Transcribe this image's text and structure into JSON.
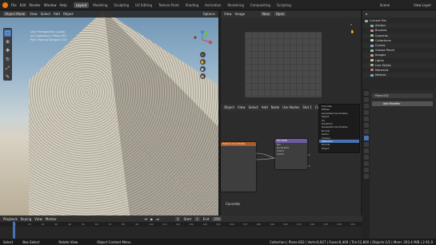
{
  "app": {
    "menus": [
      "File",
      "Edit",
      "Render",
      "Window",
      "Help"
    ],
    "workspaces": [
      "Layout",
      "Modeling",
      "Sculpting",
      "UV Editing",
      "Texture Paint",
      "Shading",
      "Animation",
      "Rendering",
      "Compositing",
      "Scripting"
    ],
    "active_workspace": "Layout",
    "scene": "Scene",
    "view_layer": "View Layer"
  },
  "viewport": {
    "mode": "Object Mode",
    "menus": [
      "View",
      "Select",
      "Add",
      "Object"
    ],
    "options": "Options",
    "overlay": [
      "User Perspective (Local)",
      "(0) Collection | Plane.001",
      "Path Tracing Sample 1/32"
    ],
    "tools": [
      "cursor",
      "move",
      "rotate",
      "scale",
      "transform",
      "annotate",
      "measure"
    ]
  },
  "image_editor": {
    "menus": [
      "View",
      "Image"
    ],
    "new": "New",
    "open": "Open"
  },
  "node_editor": {
    "menus": [
      "Object",
      "View",
      "Select",
      "Add",
      "Node"
    ],
    "use_nodes": "Use Nodes",
    "slot": "Slot 1",
    "material": "Concrete",
    "label": "Concrete",
    "dropdown": [
      "Concrete",
      "Diffuse",
      "Generated Coordinates",
      "Object",
      "UV",
      "Transform",
      "Generated Coordinates",
      "Normal",
      "Vector",
      "Camera",
      "Reflection",
      "Normal",
      "Object"
    ],
    "dropdown_selected": 10,
    "nodes": {
      "left_node": "Texture Coordinate",
      "mid_node": "Mix RGB",
      "mid_lines": [
        "Mix",
        "Generated",
        "Color1",
        "Color2"
      ]
    }
  },
  "outliner": {
    "title": "Current File",
    "items": [
      "Actions",
      "Brushes",
      "Cameras",
      "Collections",
      "Curves",
      "Grease Pencil",
      "Images",
      "Lights",
      "Line Styles",
      "Materials",
      "Meshes"
    ]
  },
  "properties": {
    "object": "Plane.002",
    "add_modifier": "Add Modifier"
  },
  "timeline": {
    "menus": [
      "Playback",
      "Keying",
      "View",
      "Marker"
    ],
    "start_label": "Start",
    "start": "1",
    "end_label": "End",
    "end": "250",
    "current": "1",
    "ticks": [
      "0",
      "10",
      "20",
      "30",
      "40",
      "50",
      "60",
      "70",
      "80",
      "90",
      "100",
      "110",
      "120",
      "130",
      "140",
      "150",
      "160",
      "170",
      "180",
      "190",
      "200",
      "210",
      "220",
      "230",
      "240",
      "250"
    ]
  },
  "status": {
    "left": [
      "Select",
      "Box Select",
      "Rotate View",
      "Object Context Menu"
    ],
    "right": "Collection | Plane.002 | Verts:6,627 | Faces:6,400 | Tris:12,800 | Objects:1/2 | Mem: 202.4 MiB | 2.91.0"
  }
}
